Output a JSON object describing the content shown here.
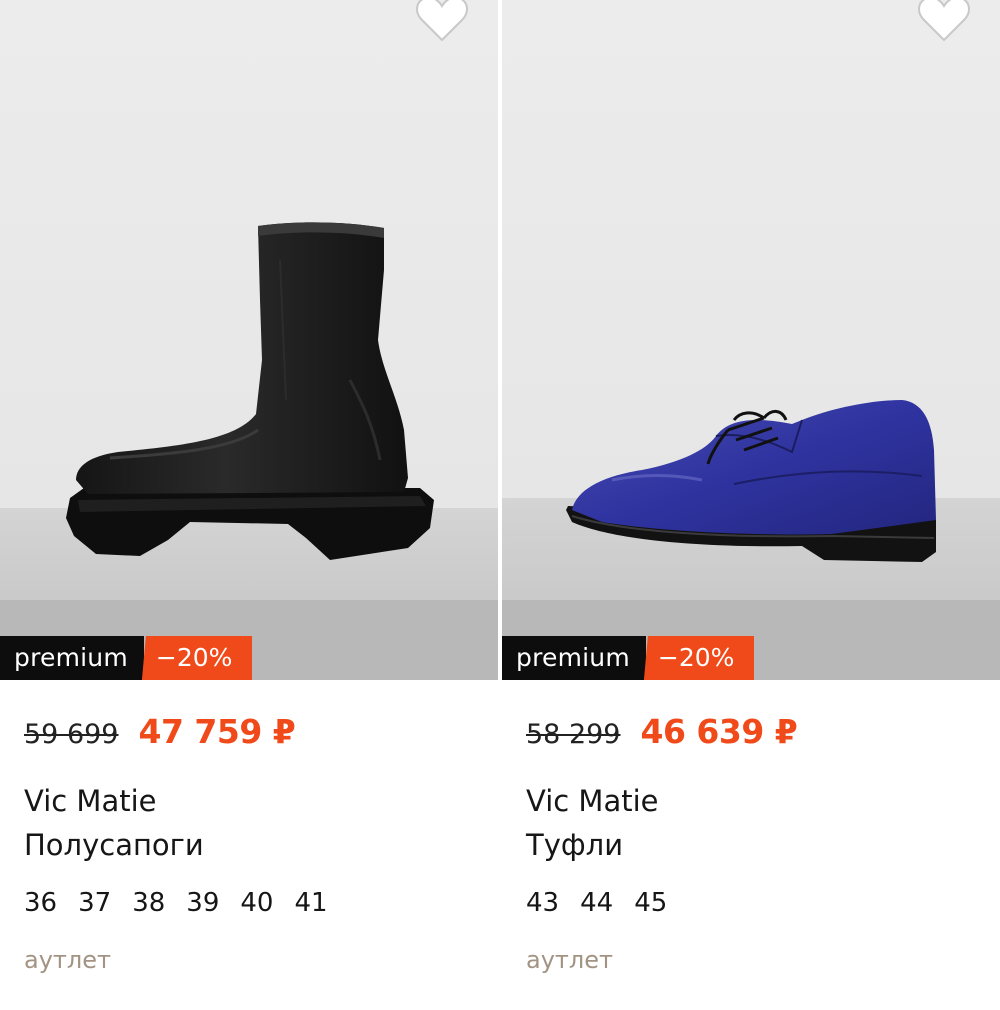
{
  "products": [
    {
      "badge_premium": "premium",
      "badge_discount": "−20%",
      "price_old": "59 699",
      "price_new": "47 759 ₽",
      "brand": "Vic Matie",
      "category": "Полусапоги",
      "sizes": [
        "36",
        "37",
        "38",
        "39",
        "40",
        "41"
      ],
      "tag": "аутлет",
      "image_icon": "black-platform-ankle-boot-image",
      "favorite_icon": "heart-icon"
    },
    {
      "badge_premium": "premium",
      "badge_discount": "−20%",
      "price_old": "58 299",
      "price_new": "46 639 ₽",
      "brand": "Vic Matie",
      "category": "Туфли",
      "sizes": [
        "43",
        "44",
        "45"
      ],
      "tag": "аутлет",
      "image_icon": "blue-leather-derby-shoe-image",
      "favorite_icon": "heart-icon"
    }
  ],
  "colors": {
    "accent": "#f04a1a",
    "premium_badge_bg": "#0d0d0d",
    "outlet_text": "#a39383",
    "photo_bg": "#ececec"
  }
}
